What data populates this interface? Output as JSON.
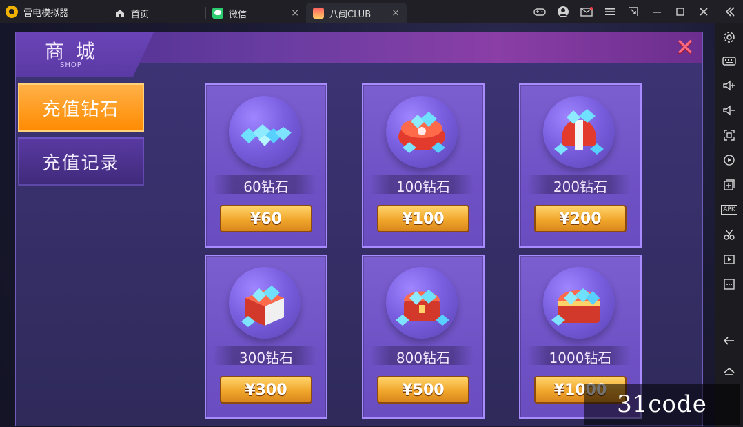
{
  "app": {
    "title": "雷电模拟器"
  },
  "tabs": [
    {
      "label": "首页"
    },
    {
      "label": "微信"
    },
    {
      "label": "八闽CLUB"
    }
  ],
  "tab_close_glyph": "×",
  "window_controls": [
    {
      "icon": "gamepad-icon"
    },
    {
      "icon": "avatar-icon"
    },
    {
      "icon": "mail-icon"
    },
    {
      "icon": "menu-icon"
    },
    {
      "icon": "shrink-icon"
    },
    {
      "icon": "minimize-icon"
    },
    {
      "icon": "maximize-icon"
    },
    {
      "icon": "close-icon"
    },
    {
      "icon": "collapse-sidebar-icon"
    }
  ],
  "sidebar": {
    "items": [
      {
        "icon": "settings-icon"
      },
      {
        "icon": "keyboard-icon"
      },
      {
        "icon": "volume-up-icon"
      },
      {
        "icon": "volume-down-icon"
      },
      {
        "icon": "screenshot-icon"
      },
      {
        "icon": "record-icon"
      },
      {
        "icon": "add-icon"
      },
      {
        "icon": "apk-icon",
        "label": "APK"
      },
      {
        "icon": "scissors-icon"
      },
      {
        "icon": "video-icon"
      },
      {
        "icon": "more-icon"
      },
      {
        "icon": "back-icon"
      },
      {
        "icon": "home-icon"
      }
    ]
  },
  "shop": {
    "title_cn": "商 城",
    "title_en": "SHOP",
    "close_glyph": "✕",
    "nav": [
      {
        "label": "充值钻石"
      },
      {
        "label": "充值记录"
      }
    ],
    "items": [
      {
        "name": "60钻石",
        "price": "¥60"
      },
      {
        "name": "100钻石",
        "price": "¥100"
      },
      {
        "name": "200钻石",
        "price": "¥200"
      },
      {
        "name": "300钻石",
        "price": "¥300"
      },
      {
        "name": "800钻石",
        "price": "¥500"
      },
      {
        "name": "1000钻石",
        "price": "¥1000"
      }
    ]
  },
  "watermark": {
    "text": "31code"
  }
}
